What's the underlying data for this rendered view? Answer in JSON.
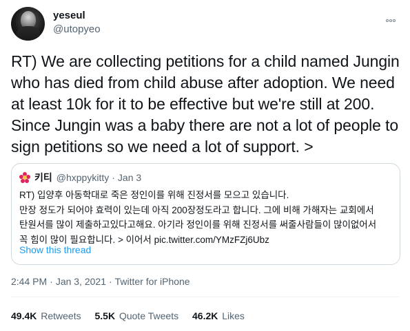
{
  "author": {
    "display_name": "yeseul",
    "handle": "@utopyeo"
  },
  "tweet": {
    "text": "RT) We are collecting petitions for a child named Jungin who has died from child abuse after adoption. We need at least 10k for it to be effective but we're still at 200. Since Jungin was a baby there are not a lot of people to sign petitions so we need a lot of support. >"
  },
  "quote": {
    "display_name": "키티",
    "handle": "@hxppykitty",
    "separator": "·",
    "date": "Jan 3",
    "lines": [
      "RT) 입양후 아동학대로 죽은 정인이를 위해 진정서를 모으고 있습니다.",
      "만장 정도가 되어야 효력이 있는데 아직 200장정도라고 합니다. 그에 비해 가해자는 교회에서",
      "탄원서를 많이 제출하고있다고해요. 아기라 정인이를 위해 진정서를 써줄사람들이 많이없어서",
      "꼭 힘이 많이 필요합니다. > 이어서 pic.twitter.com/YMzFZj6Ubz"
    ],
    "show_thread": "Show this thread"
  },
  "meta": {
    "time": "2:44 PM",
    "separator": "·",
    "date": "Jan 3, 2021",
    "source": "Twitter for iPhone"
  },
  "stats": {
    "retweets_count": "49.4K",
    "retweets_label": "Retweets",
    "quotes_count": "5.5K",
    "quotes_label": "Quote Tweets",
    "likes_count": "46.2K",
    "likes_label": "Likes"
  },
  "icons": {
    "more": "more-options-icon",
    "quote_avatar": "flower-avatar-icon"
  },
  "colors": {
    "link": "#1d9bf0",
    "secondary_text": "#536471",
    "border": "#cfd9de"
  }
}
